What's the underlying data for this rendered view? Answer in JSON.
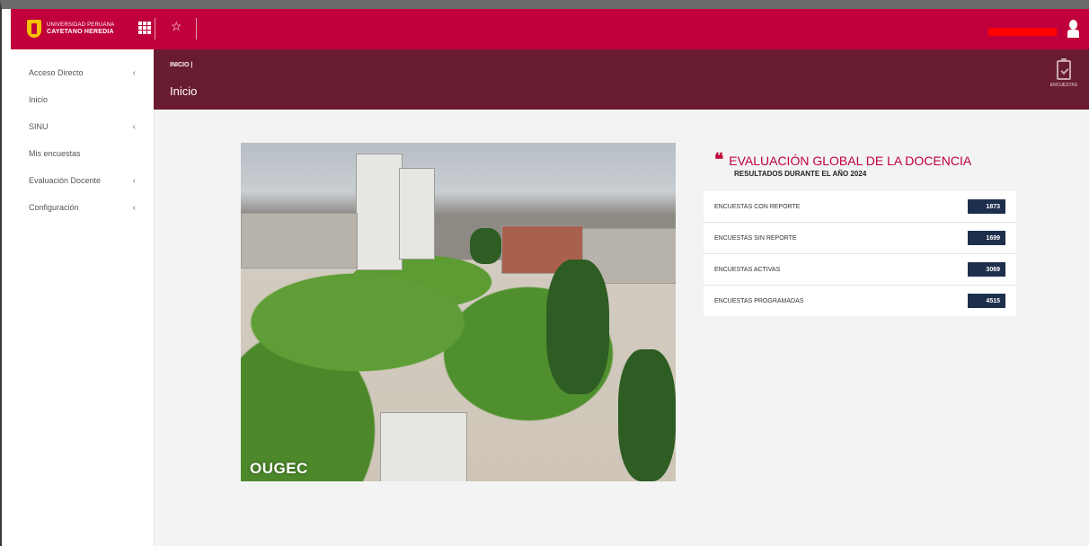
{
  "brand": {
    "line1": "UNIVERSIDAD PERUANA",
    "line2": "CAYETANO HEREDIA"
  },
  "topbar": {
    "apps_icon": "grid-icon",
    "favorites_icon": "star-icon",
    "user_icon": "user-icon",
    "accent_color": "#c0003a"
  },
  "sidebar": {
    "items": [
      {
        "label": "Acceso Directo",
        "has_submenu": true
      },
      {
        "label": "Inicio",
        "has_submenu": false
      },
      {
        "label": "SINU",
        "has_submenu": true
      },
      {
        "label": "Mis encuestas",
        "has_submenu": false
      },
      {
        "label": "Evaluación Docente",
        "has_submenu": true
      },
      {
        "label": "Configuración",
        "has_submenu": true
      }
    ],
    "chevron": "‹"
  },
  "header": {
    "breadcrumb": "INICIO |",
    "title": "Inicio",
    "encuestas_label": "ENCUESTAS",
    "band_color": "#691b2f"
  },
  "hero": {
    "image_label": "OUGEC"
  },
  "evaluation": {
    "quote_icon": "❝",
    "title": "EVALUACIÓN GLOBAL DE LA DOCENCIA",
    "subtitle": "RESULTADOS DURANTE EL AÑO 2024",
    "stats": [
      {
        "label": "ENCUESTAS CON REPORTE",
        "value": "1873"
      },
      {
        "label": "ENCUESTAS SIN REPORTE",
        "value": "1699"
      },
      {
        "label": "ENCUESTAS ACTIVAS",
        "value": "3069"
      },
      {
        "label": "ENCUESTAS PROGRAMADAS",
        "value": "4515"
      }
    ],
    "badge_color": "#1d2f4d"
  }
}
